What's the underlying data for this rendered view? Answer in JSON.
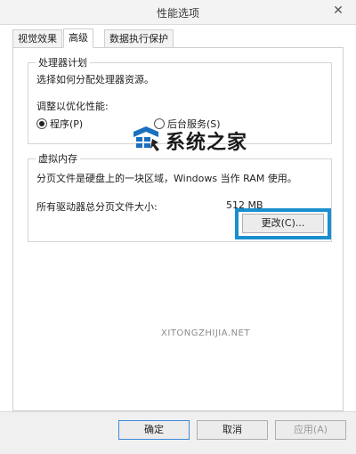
{
  "window": {
    "title": "性能选项",
    "close_glyph": "✕"
  },
  "tabs": [
    "视觉效果",
    "高级",
    "数据执行保护"
  ],
  "processor": {
    "group_title": "处理器计划",
    "description": "选择如何分配处理器资源。",
    "adjust_label": "调整以优化性能:",
    "option_program": "程序(P)",
    "option_service": "后台服务(S)"
  },
  "virtual_memory": {
    "group_title": "虚拟内存",
    "description": "分页文件是硬盘上的一块区域，Windows 当作 RAM 使用。",
    "total_label": "所有驱动器总分页文件大小:",
    "total_value": "512 MB",
    "change_button": "更改(C)..."
  },
  "buttons": {
    "ok": "确定",
    "cancel": "取消",
    "apply": "应用(A)"
  },
  "watermark": {
    "text": "系统之家",
    "url": "XITONGZHIJIA.NET"
  },
  "colors": {
    "highlight": "#1a8fcf",
    "accent": "#3c8ad6"
  }
}
